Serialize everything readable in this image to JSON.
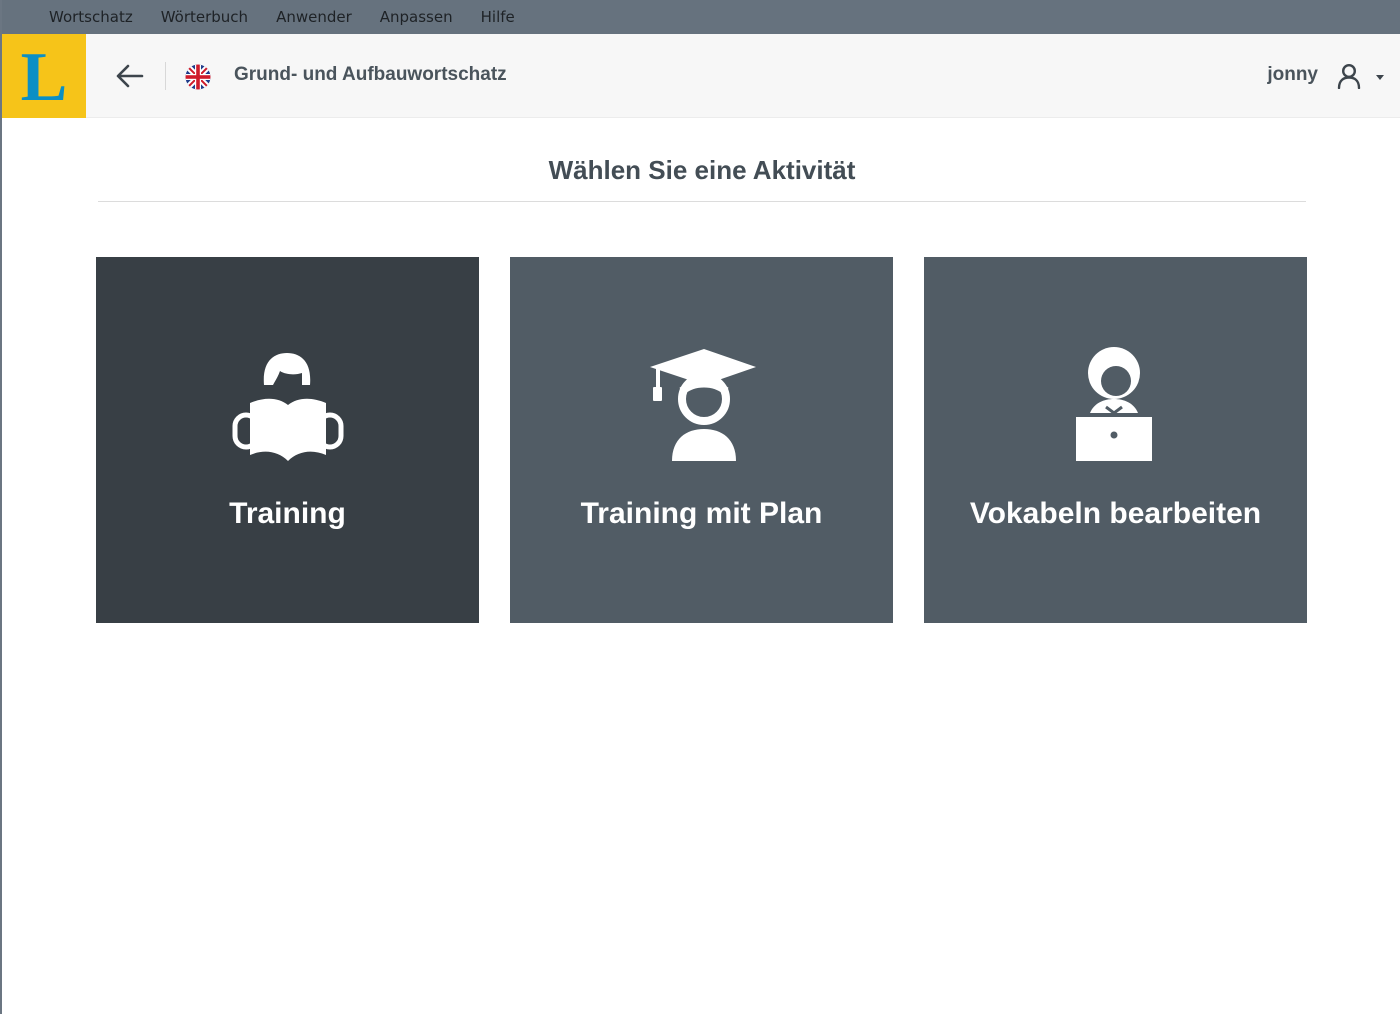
{
  "menubar": {
    "items": [
      {
        "label": "Wortschatz"
      },
      {
        "label": "Wörterbuch"
      },
      {
        "label": "Anwender"
      },
      {
        "label": "Anpassen"
      },
      {
        "label": "Hilfe"
      }
    ]
  },
  "header": {
    "logo_letter": "L",
    "course_title": "Grund- und Aufbauwortschatz",
    "user_name": "jonny",
    "icons": {
      "back": "arrow-left-icon",
      "flag": "uk-flag-icon",
      "user": "user-icon",
      "caret": "caret-down-icon"
    }
  },
  "main": {
    "title": "Wählen Sie eine Aktivität",
    "cards": [
      {
        "label": "Training",
        "icon": "reader-with-book-icon",
        "selected": true
      },
      {
        "label": "Training mit Plan",
        "icon": "graduate-cap-icon",
        "selected": false
      },
      {
        "label": "Vokabeln bearbeiten",
        "icon": "person-at-laptop-icon",
        "selected": false
      }
    ]
  },
  "colors": {
    "menubar_bg": "#66727e",
    "logo_bg": "#f6c419",
    "logo_letter": "#0b8fc4",
    "card_bg": "#515c65",
    "card_active_bg": "#383f45",
    "text_dark": "#434d55"
  }
}
